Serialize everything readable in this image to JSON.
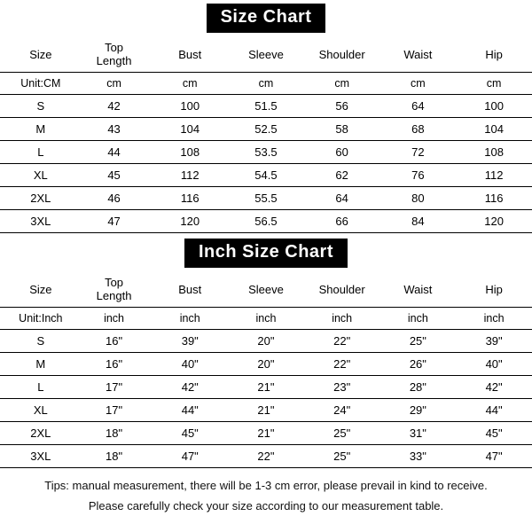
{
  "chart_data": [
    {
      "type": "table",
      "title": "Size Chart",
      "unit_label": "Unit:CM",
      "unit_value": "cm",
      "columns": [
        "Size",
        "Top Length",
        "Bust",
        "Sleeve",
        "Shoulder",
        "Waist",
        "Hip"
      ],
      "rows": [
        {
          "size": "S",
          "top_length": "42",
          "bust": "100",
          "sleeve": "51.5",
          "shoulder": "56",
          "waist": "64",
          "hip": "100"
        },
        {
          "size": "M",
          "top_length": "43",
          "bust": "104",
          "sleeve": "52.5",
          "shoulder": "58",
          "waist": "68",
          "hip": "104"
        },
        {
          "size": "L",
          "top_length": "44",
          "bust": "108",
          "sleeve": "53.5",
          "shoulder": "60",
          "waist": "72",
          "hip": "108"
        },
        {
          "size": "XL",
          "top_length": "45",
          "bust": "112",
          "sleeve": "54.5",
          "shoulder": "62",
          "waist": "76",
          "hip": "112"
        },
        {
          "size": "2XL",
          "top_length": "46",
          "bust": "116",
          "sleeve": "55.5",
          "shoulder": "64",
          "waist": "80",
          "hip": "116"
        },
        {
          "size": "3XL",
          "top_length": "47",
          "bust": "120",
          "sleeve": "56.5",
          "shoulder": "66",
          "waist": "84",
          "hip": "120"
        }
      ]
    },
    {
      "type": "table",
      "title": "Inch Size Chart",
      "unit_label": "Unit:Inch",
      "unit_value": "inch",
      "columns": [
        "Size",
        "Top Length",
        "Bust",
        "Sleeve",
        "Shoulder",
        "Waist",
        "Hip"
      ],
      "rows": [
        {
          "size": "S",
          "top_length": "16\"",
          "bust": "39\"",
          "sleeve": "20\"",
          "shoulder": "22\"",
          "waist": "25\"",
          "hip": "39\""
        },
        {
          "size": "M",
          "top_length": "16\"",
          "bust": "40\"",
          "sleeve": "20\"",
          "shoulder": "22\"",
          "waist": "26\"",
          "hip": "40\""
        },
        {
          "size": "L",
          "top_length": "17\"",
          "bust": "42\"",
          "sleeve": "21\"",
          "shoulder": "23\"",
          "waist": "28\"",
          "hip": "42\""
        },
        {
          "size": "XL",
          "top_length": "17\"",
          "bust": "44\"",
          "sleeve": "21\"",
          "shoulder": "24\"",
          "waist": "29\"",
          "hip": "44\""
        },
        {
          "size": "2XL",
          "top_length": "18\"",
          "bust": "45\"",
          "sleeve": "21\"",
          "shoulder": "25\"",
          "waist": "31\"",
          "hip": "45\""
        },
        {
          "size": "3XL",
          "top_length": "18\"",
          "bust": "47\"",
          "sleeve": "22\"",
          "shoulder": "25\"",
          "waist": "33\"",
          "hip": "47\""
        }
      ]
    }
  ],
  "tips": {
    "line1": "Tips: manual measurement, there will be 1-3 cm error, please prevail in kind to receive.",
    "line2": "Please carefully check your size according to our measurement table."
  }
}
